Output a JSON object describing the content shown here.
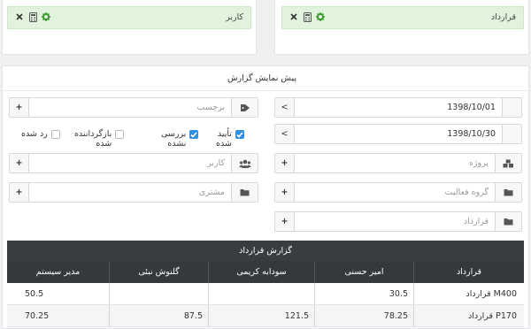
{
  "filters": {
    "contract_chip_label": "قرارداد",
    "user_chip_label": "کاربر"
  },
  "panel": {
    "title": "پیش نمایش گزارش"
  },
  "form": {
    "date_from": "1398/10/01",
    "date_to": "1398/10/30",
    "tag_placeholder": "برچسب",
    "project_placeholder": "پروژه",
    "user_placeholder": "کاربر",
    "activity_group_placeholder": "گروه فعالیت",
    "customer_placeholder": "مشتری",
    "contract_placeholder": "قرارداد",
    "chevron": "<",
    "plus": "+"
  },
  "status_checks": [
    {
      "label_line1": "تأیید",
      "label_line2": "شده",
      "checked": true
    },
    {
      "label_line1": "بررسی",
      "label_line2": "نشده",
      "checked": true
    },
    {
      "label_line1": "بازگرداننده",
      "label_line2": "شده",
      "checked": false
    },
    {
      "label_line1": "رد شده",
      "label_line2": "",
      "checked": false
    }
  ],
  "report": {
    "caption": "گزارش قرارداد",
    "columns": [
      "قرارداد",
      "امیر حسنی",
      "سودابه کریمی",
      "گلنوش نبئی",
      "مدیر سیستم"
    ],
    "rows": [
      [
        "قرارداد M400",
        "30.5",
        "",
        "",
        "50.5"
      ],
      [
        "قرارداد P170",
        "78.25",
        "121.5",
        "87.5",
        "70.25"
      ]
    ]
  },
  "colors": {
    "chip_bg": "#e2f3dd",
    "icon_green": "#3c9a2e",
    "checkbox_blue": "#2f8fe0",
    "table_header": "#35393c"
  }
}
